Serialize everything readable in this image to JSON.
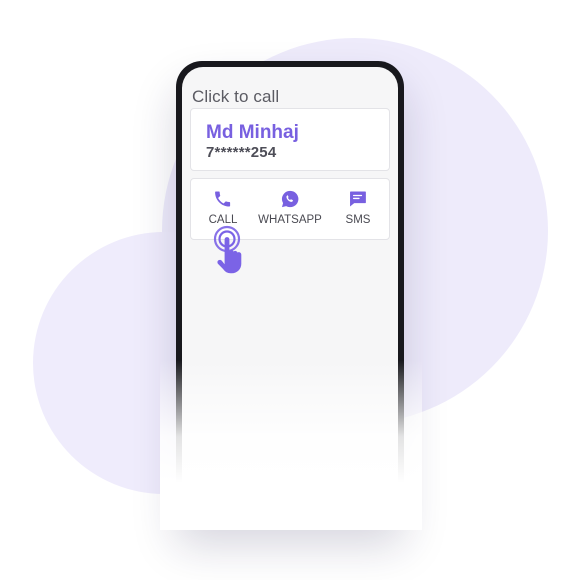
{
  "header": {
    "title": "Click to call"
  },
  "contact": {
    "name": "Md Minhaj",
    "number": "7******254"
  },
  "actions": [
    {
      "label": "CALL",
      "icon": "phone-icon"
    },
    {
      "label": "WHATSAPP",
      "icon": "whatsapp-icon"
    },
    {
      "label": "SMS",
      "icon": "sms-icon"
    }
  ],
  "colors": {
    "accent": "#7860e0",
    "blob": "#eeebfb",
    "phone_frame": "#18181d",
    "screen_bg": "#f6f6f7"
  }
}
